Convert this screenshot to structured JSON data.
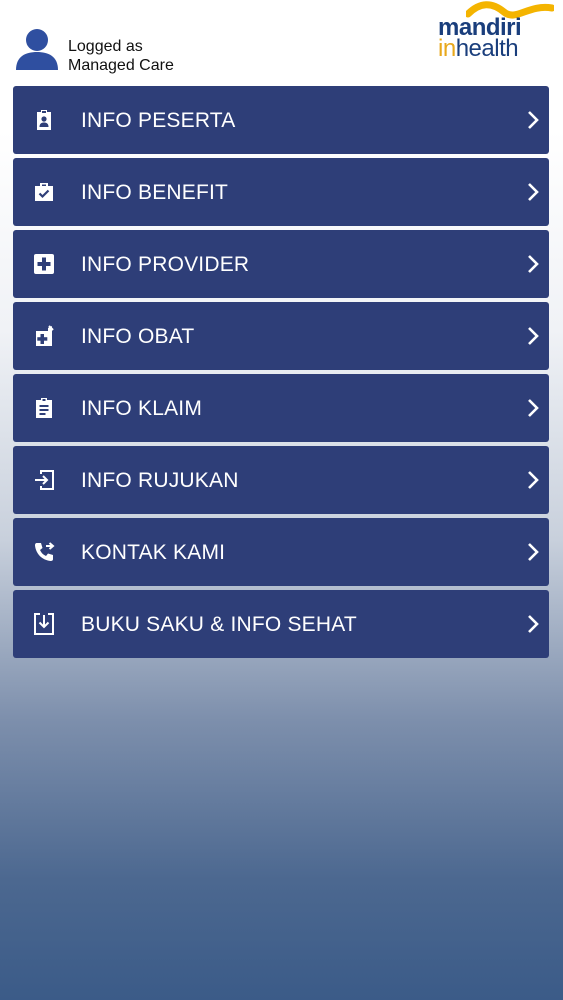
{
  "header": {
    "user_line1": "Logged as",
    "user_line2": "Managed Care",
    "logo_brand": "mandiri",
    "logo_in": "in",
    "logo_health": "health"
  },
  "menu": {
    "items": [
      {
        "label": "INFO PESERTA",
        "icon": "badge-icon"
      },
      {
        "label": "INFO BENEFIT",
        "icon": "medical-bag-icon"
      },
      {
        "label": "INFO PROVIDER",
        "icon": "hospital-plus-icon"
      },
      {
        "label": "INFO OBAT",
        "icon": "medicine-icon"
      },
      {
        "label": "INFO KLAIM",
        "icon": "clipboard-icon"
      },
      {
        "label": "INFO RUJUKAN",
        "icon": "login-icon"
      },
      {
        "label": "KONTAK KAMI",
        "icon": "phone-forward-icon"
      },
      {
        "label": "BUKU SAKU & INFO SEHAT",
        "icon": "download-icon"
      }
    ]
  },
  "colors": {
    "menu_bg": "#2e3e78",
    "brand_blue": "#1a3e7c",
    "brand_gold": "#e8a81c"
  }
}
